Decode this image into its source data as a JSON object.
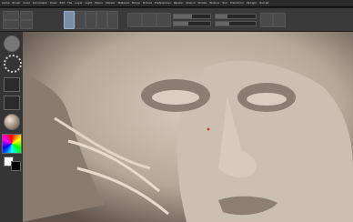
{
  "menu": {
    "items": [
      "Alpha",
      "Brush",
      "Color",
      "Document",
      "Draw",
      "Edit",
      "File",
      "Layer",
      "Light",
      "Macro",
      "Marker",
      "Material",
      "Movie",
      "Picture",
      "Preferences",
      "Render",
      "Stencil",
      "Stroke",
      "Texture",
      "Tool",
      "Transform",
      "Zplugin",
      "Zscript"
    ]
  },
  "colors": {
    "skin": "#c7b9ab",
    "shadow": "#5d5046",
    "ui_bg": "#3a3a3a",
    "accent": "#7a8ea8"
  }
}
